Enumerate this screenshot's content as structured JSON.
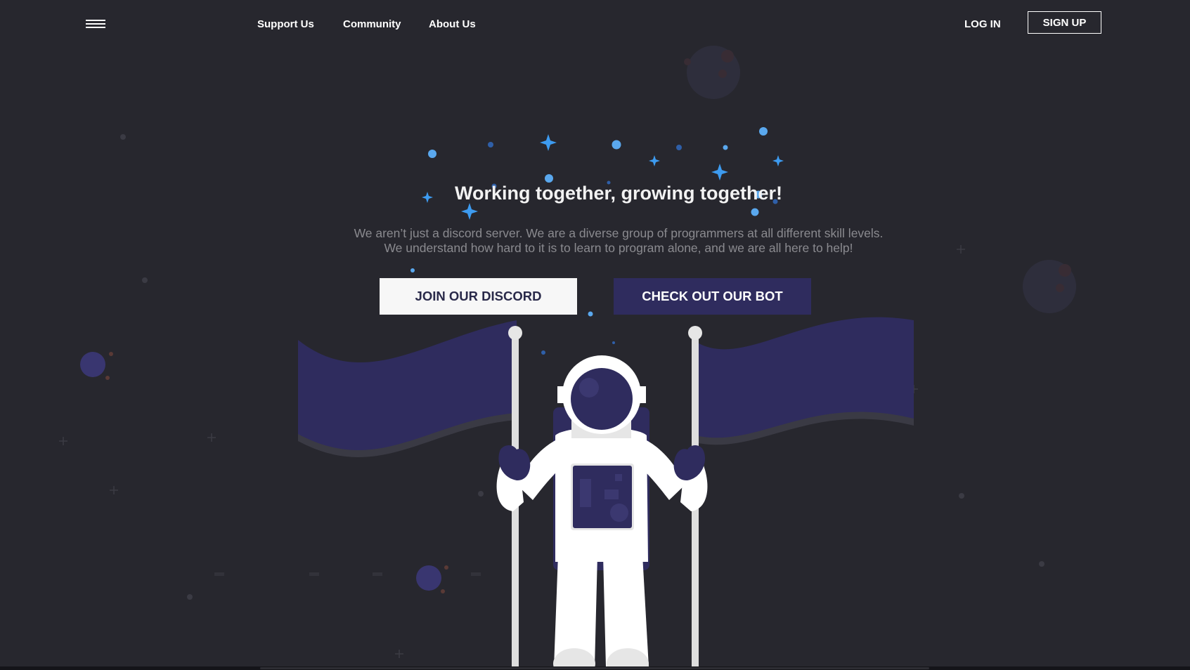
{
  "nav": {
    "menu_icon": "hamburger-menu-icon",
    "links": {
      "support": "Support Us",
      "community": "Community",
      "about": "About Us"
    },
    "login_label": "LOG IN",
    "signup_label": "SIGN UP"
  },
  "hero": {
    "title": "Working together, growing together!",
    "text_line1": "We aren’t just a discord server. We are a diverse group of programmers at all different skill levels.",
    "text_line2": "We understand how hard to it is to learn to program alone, and we are all here to help!",
    "discord_button": "JOIN OUR DISCORD",
    "bot_button": "CHECK OUT OUR BOT"
  },
  "colors": {
    "background": "#27272e",
    "accent_navy": "#2f2c5e",
    "star_blue": "#3d9bf0",
    "text_muted": "#8a8a8f",
    "button_light": "#f7f7f7"
  }
}
